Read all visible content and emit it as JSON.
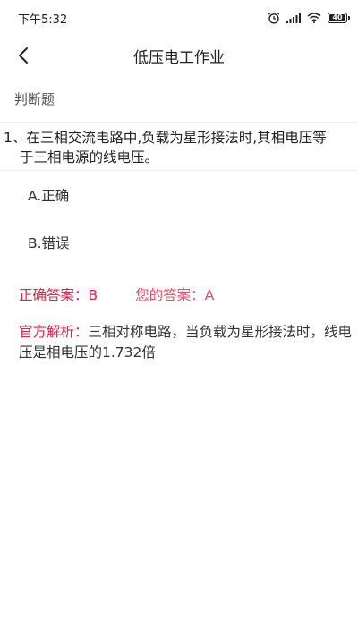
{
  "status_bar": {
    "time": "下午5:32",
    "battery": "40",
    "icons": [
      "alarm-icon",
      "signal-icon",
      "wifi-icon",
      "battery-icon"
    ]
  },
  "nav": {
    "title": "低压电工作业",
    "back_icon": "chevron-left-icon"
  },
  "section": {
    "label": "判断题"
  },
  "question": {
    "line1": "1、在三相交流电路中,负载为星形接法时,其相电压等",
    "line2": "于三相电源的线电压。"
  },
  "options": [
    {
      "label": "A.正确"
    },
    {
      "label": "B.错误"
    }
  ],
  "answer": {
    "correct": "正确答案：B",
    "yours": "您的答案：A"
  },
  "analysis": {
    "label": "官方解析：",
    "line1_text": "三相对称电路，当负载为星形接法时，线电",
    "line2_text": "压是相电压的1.732倍"
  },
  "colors": {
    "accent": "#e0234e",
    "your_answer": "#ec4e6f"
  }
}
